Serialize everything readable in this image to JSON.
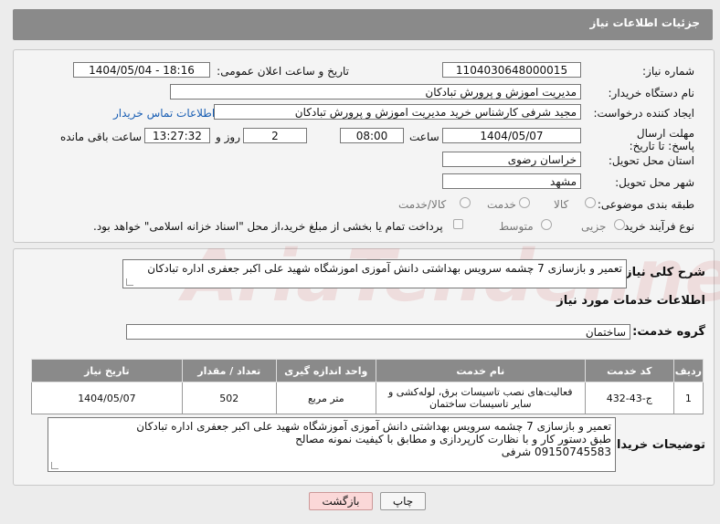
{
  "header": {
    "title": "جزئیات اطلاعات نیاز"
  },
  "fields": {
    "need_number_label": "شماره نیاز:",
    "need_number": "1104030648000015",
    "announce_label": "تاریخ و ساعت اعلان عمومی:",
    "announce_value": "1404/05/04 - 18:16",
    "buyer_org_label": "نام دستگاه خریدار:",
    "buyer_org": "مدیریت اموزش و پرورش تبادکان",
    "creator_label": "ایجاد کننده درخواست:",
    "creator": "مجید شرفی کارشناس خرید مدیریت اموزش و پرورش تبادکان",
    "contact_link": "اطلاعات تماس خریدار",
    "deadline_label": "مهلت ارسال پاسخ: تا تاریخ:",
    "deadline_date": "1404/05/07",
    "time_label": "ساعت",
    "deadline_time": "08:00",
    "days_value": "2",
    "days_label": "روز و",
    "remaining_time": "13:27:32",
    "remaining_label": "ساعت باقی مانده",
    "province_label": "استان محل تحویل:",
    "province": "خراسان رضوی",
    "city_label": "شهر محل تحویل:",
    "city": "مشهد",
    "category_label": "طبقه بندی موضوعی:",
    "category_options": [
      "کالا",
      "خدمت",
      "کالا/خدمت"
    ],
    "process_label": "نوع فرآیند خرید :",
    "process_options": [
      "جزیی",
      "متوسط"
    ],
    "treasury_note": "پرداخت تمام یا بخشی از مبلغ خرید،از محل \"اسناد خزانه اسلامی\" خواهد بود."
  },
  "summary": {
    "label": "شرح کلی نیاز:",
    "text": "تعمیر و بازسازی 7 چشمه سرویس بهداشتی دانش آموزی اموزشگاه شهید علی اکبر جعفری اداره تبادکان"
  },
  "services": {
    "section_title": "اطلاعات خدمات مورد نیاز",
    "group_label": "گروه خدمت:",
    "group_value": "ساختمان",
    "columns": [
      "ردیف",
      "کد خدمت",
      "نام خدمت",
      "واحد اندازه گیری",
      "تعداد / مقدار",
      "تاریخ نیاز"
    ],
    "rows": [
      {
        "idx": "1",
        "code": "ج-43-432",
        "name": "فعالیت‌های نصب تاسیسات برق، لوله‌کشی و سایر تاسیسات ساختمان",
        "unit": "متر مربع",
        "qty": "502",
        "date": "1404/05/07"
      }
    ]
  },
  "buyer_notes": {
    "label": "توضیحات خریدار:",
    "lines": [
      "تعمیر و بازسازی 7 چشمه سرویس بهداشتی دانش آموزی آموزشگاه شهید علی اکبر جعفری اداره تبادکان",
      "طبق دستور کار و با نظارت کارپردازی و مطابق با کیفیت نمونه مصالح",
      "09150745583 شرفی"
    ]
  },
  "buttons": {
    "print": "چاپ",
    "back": "بازگشت"
  },
  "watermark": "AriaTender.net"
}
